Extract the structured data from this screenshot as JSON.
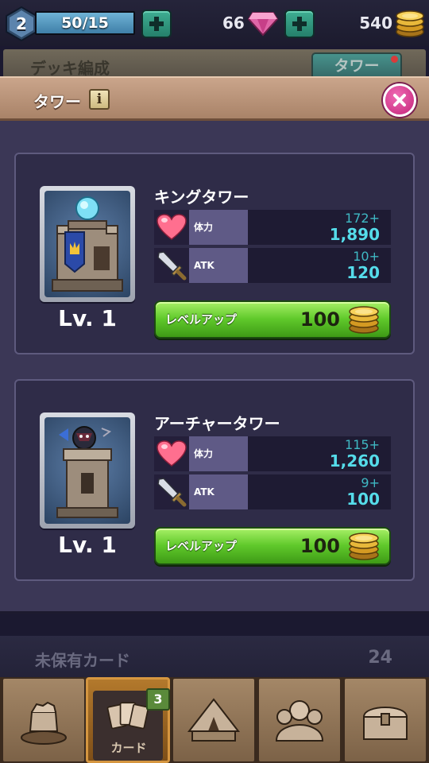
{
  "status": {
    "player_level": "2",
    "stamina": "50/15",
    "stamina_fill": 1.0,
    "gems": "66",
    "gold": "540"
  },
  "background": {
    "deck_title": "デッキ編成",
    "tower_tab": "タワー"
  },
  "modal": {
    "title": "タワー",
    "info_glyph": "i",
    "towers": [
      {
        "name": "キングタワー",
        "level": "Lv. 1",
        "hp_label": "体力",
        "hp_bonus": "172+",
        "hp_value": "1,890",
        "atk_label": "ATK",
        "atk_bonus": "10+",
        "atk_value": "120",
        "levelup_label": "レベルアップ",
        "levelup_cost": "100"
      },
      {
        "name": "アーチャータワー",
        "level": "Lv. 1",
        "hp_label": "体力",
        "hp_bonus": "115+",
        "hp_value": "1,260",
        "atk_label": "ATK",
        "atk_bonus": "9+",
        "atk_value": "100",
        "levelup_label": "レベルアップ",
        "levelup_cost": "100"
      }
    ]
  },
  "unowned": {
    "label": "未保有カード",
    "count": "24"
  },
  "nav": {
    "tabs": [
      {
        "name": "battle",
        "icon": "fist-icon"
      },
      {
        "name": "cards",
        "icon": "cards-icon",
        "label": "カード",
        "badge": "3",
        "active": true
      },
      {
        "name": "tent",
        "icon": "tent-icon"
      },
      {
        "name": "social",
        "icon": "people-icon"
      },
      {
        "name": "shop",
        "icon": "chest-icon"
      }
    ]
  },
  "colors": {
    "stat_value": "#55dcea",
    "levelup_green": "#60c92b",
    "close_pink": "#c4247a",
    "modal_bg": "#3b3756"
  }
}
